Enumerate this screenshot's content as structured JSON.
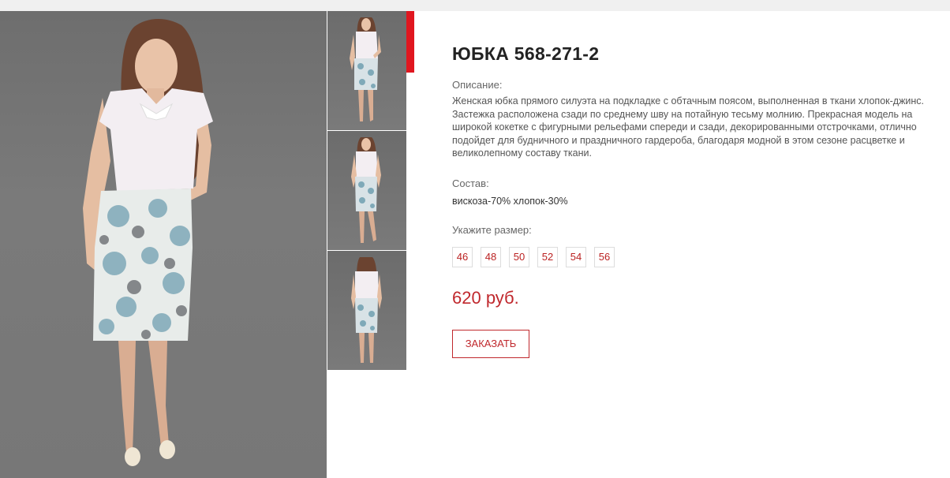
{
  "product": {
    "title": "ЮБКА 568-271-2",
    "description_label": "Описание:",
    "description": "Женская юбка прямого силуэта на подкладке с обтачным поясом, выполненная в ткани хлопок-джинс. Застежка расположена сзади по среднему шву на потайную тесьму молнию. Прекрасная модель на широкой кокетке с фигурными рельефами спереди и сзади, декорированными отстрочками, отлично подойдет для будничного и праздничного гардероба, благодаря модной в этом сезоне расцветке и великолепному составу ткани.",
    "composition_label": "Состав:",
    "composition": "вискоза-70% хлопок-30%",
    "size_label": "Укажите размер:",
    "sizes": [
      "46",
      "48",
      "50",
      "52",
      "54",
      "56"
    ],
    "price": "620 руб.",
    "order_button": "ЗАКАЗАТЬ"
  },
  "gallery": {
    "main_image": "model-front-photo",
    "thumbnails": [
      "model-front-photo",
      "model-front-photo-2",
      "model-back-photo"
    ]
  },
  "colors": {
    "accent": "#e0161f",
    "price": "#c0282d",
    "background": "#ffffff"
  }
}
